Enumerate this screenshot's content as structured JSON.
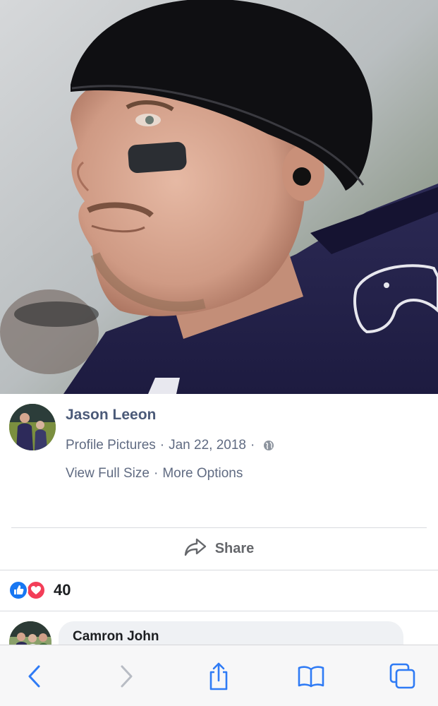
{
  "post": {
    "author": "Jason Leeon",
    "album": "Profile Pictures",
    "date": "Jan 22, 2018",
    "separator": "·",
    "view_full_size": "View Full Size",
    "more_options": "More Options",
    "privacy_icon": "globe-icon"
  },
  "actions": {
    "share_label": "Share",
    "share_icon": "share-arrow-icon"
  },
  "reactions": {
    "count": "40",
    "types": [
      "like",
      "love"
    ],
    "colors": {
      "like": "#1877f2",
      "love": "#f33e58"
    }
  },
  "comments": [
    {
      "author": "Camron John"
    }
  ],
  "browser_toolbar": {
    "buttons": [
      "back-icon",
      "forward-icon",
      "share-icon",
      "bookmarks-icon",
      "tabs-icon"
    ],
    "accent": "#2f7bf5"
  },
  "colors": {
    "author_link": "#4b5a78",
    "meta_text": "#606b82",
    "divider": "#d8dadf"
  }
}
